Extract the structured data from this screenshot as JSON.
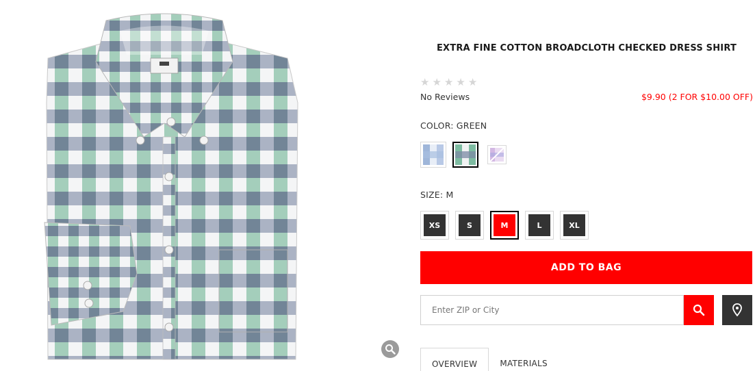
{
  "product": {
    "title": "EXTRA FINE COTTON BROADCLOTH CHECKED DRESS SHIRT",
    "rating_stars": 0,
    "reviews_text": "No Reviews",
    "price_text": "$9.90 (2 FOR $10.00 OFF)"
  },
  "color": {
    "label": "COLOR: GREEN",
    "swatches": [
      {
        "name": "blue",
        "selected": false
      },
      {
        "name": "green",
        "selected": true
      },
      {
        "name": "pink",
        "selected": false
      }
    ]
  },
  "size": {
    "label": "SIZE: M",
    "options": [
      "XS",
      "S",
      "M",
      "L",
      "XL"
    ],
    "selected": "M"
  },
  "actions": {
    "add_to_bag": "ADD TO BAG",
    "zip_placeholder": "Enter ZIP or City"
  },
  "tabs": [
    "OVERVIEW",
    "MATERIALS"
  ],
  "icons": {
    "zoom": "zoom-icon",
    "search": "search-icon",
    "location": "location-pin-icon"
  },
  "colors": {
    "accent": "#ff0000",
    "dark": "#333333"
  }
}
